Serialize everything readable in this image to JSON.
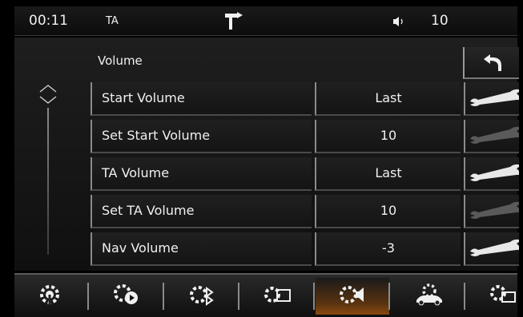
{
  "status_bar": {
    "time": "00:11",
    "ta": "TA",
    "nav_icon": "turn-right-icon",
    "volume_icon": "speaker-icon",
    "volume": "10"
  },
  "section": {
    "title": "Volume",
    "back_icon": "back-arrow-icon"
  },
  "settings": [
    {
      "label": "Start Volume",
      "value": "Last"
    },
    {
      "label": "Set Start Volume",
      "value": "10"
    },
    {
      "label": "TA Volume",
      "value": "Last"
    },
    {
      "label": "Set TA Volume",
      "value": "10"
    },
    {
      "label": "Nav Volume",
      "value": "-3"
    }
  ],
  "tabs": [
    {
      "icon": "gear-antenna-icon"
    },
    {
      "icon": "gear-play-icon"
    },
    {
      "icon": "gear-bluetooth-icon"
    },
    {
      "icon": "gear-display-icon"
    },
    {
      "icon": "gear-speaker-icon",
      "active": true
    },
    {
      "icon": "gear-car-icon"
    },
    {
      "icon": "gear-screen-icon"
    }
  ],
  "colors": {
    "background": "#000000",
    "text": "#f0f0f0",
    "active_tab": "#8a4a10"
  }
}
